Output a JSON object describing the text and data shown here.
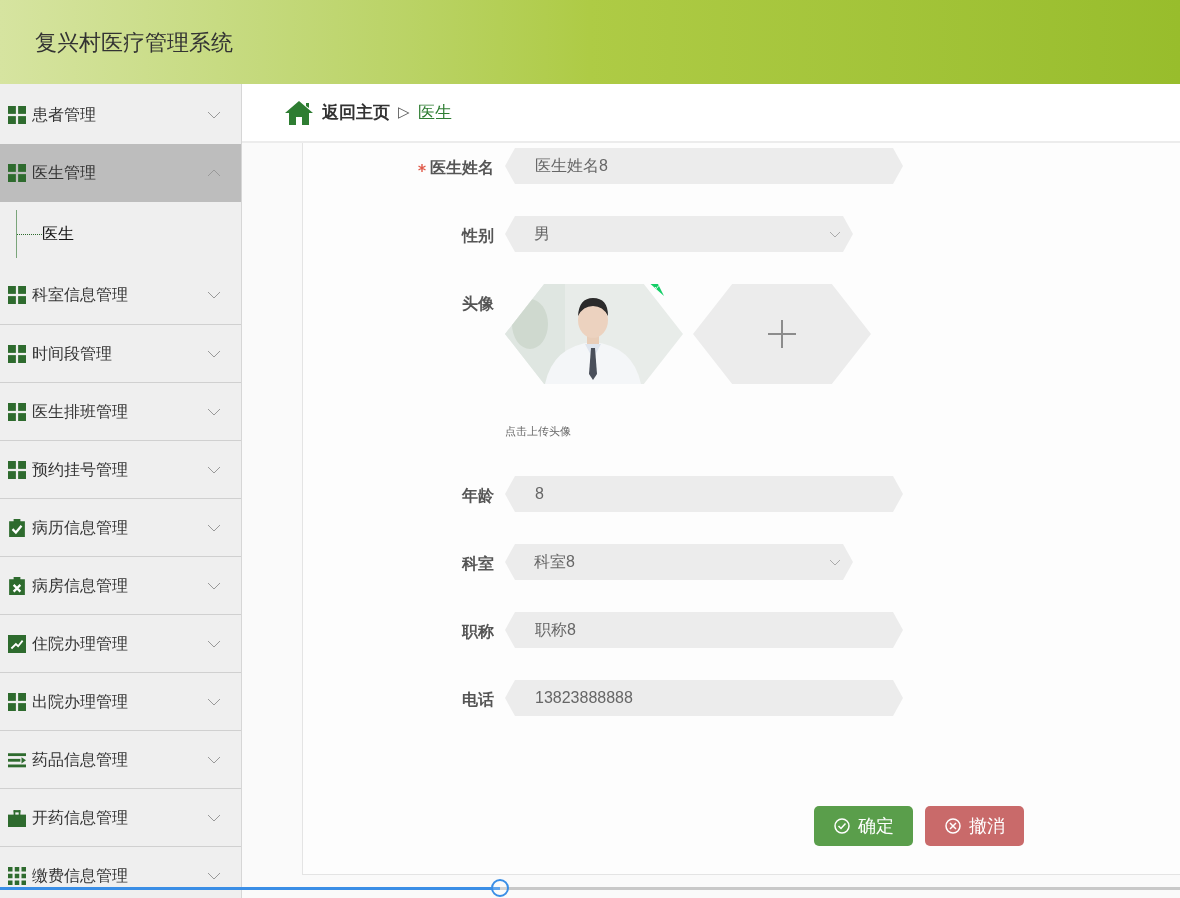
{
  "app": {
    "title": "复兴村医疗管理系统"
  },
  "sidebar": {
    "items": [
      {
        "label": "患者管理",
        "kind": "grid",
        "expanded": false,
        "selected": false
      },
      {
        "label": "医生管理",
        "kind": "grid",
        "expanded": true,
        "selected": true,
        "children": [
          {
            "label": "医生"
          }
        ]
      },
      {
        "label": "科室信息管理",
        "kind": "grid",
        "expanded": false,
        "selected": false
      },
      {
        "label": "时间段管理",
        "kind": "grid",
        "expanded": false,
        "selected": false
      },
      {
        "label": "医生排班管理",
        "kind": "grid",
        "expanded": false,
        "selected": false
      },
      {
        "label": "预约挂号管理",
        "kind": "grid",
        "expanded": false,
        "selected": false
      },
      {
        "label": "病历信息管理",
        "kind": "clipboard-check",
        "expanded": false,
        "selected": false
      },
      {
        "label": "病房信息管理",
        "kind": "clipboard-x",
        "expanded": false,
        "selected": false
      },
      {
        "label": "住院办理管理",
        "kind": "chart",
        "expanded": false,
        "selected": false
      },
      {
        "label": "出院办理管理",
        "kind": "grid",
        "expanded": false,
        "selected": false
      },
      {
        "label": "药品信息管理",
        "kind": "list",
        "expanded": false,
        "selected": false
      },
      {
        "label": "开药信息管理",
        "kind": "briefcase",
        "expanded": false,
        "selected": false
      },
      {
        "label": "缴费信息管理",
        "kind": "grid9",
        "expanded": false,
        "selected": false
      }
    ]
  },
  "breadcrumb": {
    "home": "返回主页",
    "separator": "▷",
    "current": "医生"
  },
  "form": {
    "fields": [
      {
        "kind": "text",
        "label": "医生姓名",
        "required": true,
        "value": "医生姓名8"
      },
      {
        "kind": "select",
        "label": "性别",
        "required": false,
        "value": "男"
      },
      {
        "label": "头像",
        "required": false,
        "hint": "点击上传头像"
      },
      {
        "kind": "text",
        "label": "年龄",
        "required": false,
        "value": "8"
      },
      {
        "kind": "select",
        "label": "科室",
        "required": false,
        "value": "科室8"
      },
      {
        "kind": "text",
        "label": "职称",
        "required": false,
        "value": "职称8"
      },
      {
        "kind": "text",
        "label": "电话",
        "required": false,
        "value": "13823888888"
      }
    ],
    "buttons": [
      {
        "kind": "confirm",
        "label": "确定"
      },
      {
        "kind": "cancel",
        "label": "撤消"
      }
    ]
  },
  "video_player": {
    "level": 0.424
  }
}
